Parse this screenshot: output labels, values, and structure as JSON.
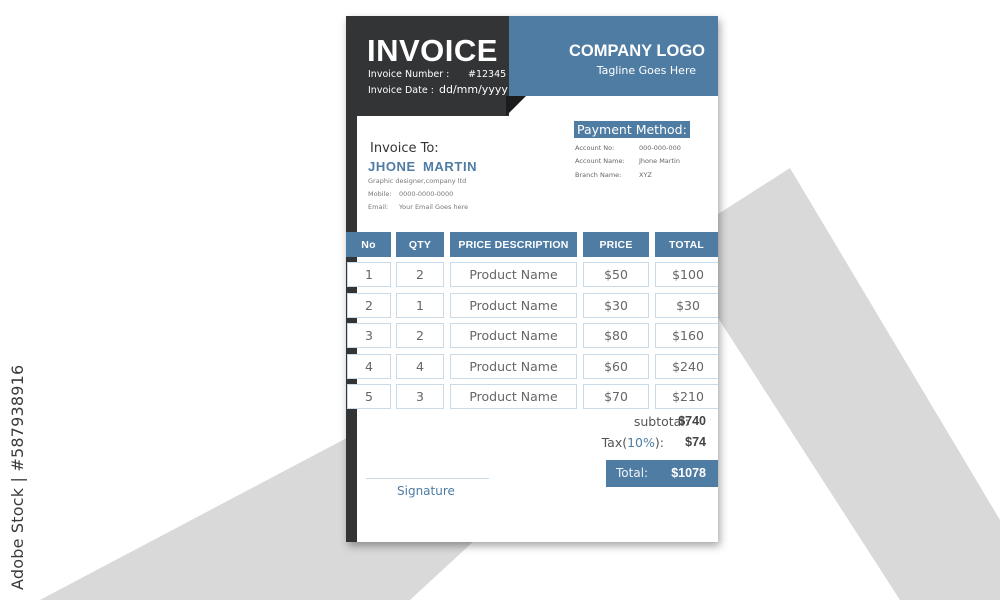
{
  "colors": {
    "accent": "#4f7ca3",
    "dark": "#333435",
    "background_shape": "#d9d9d9",
    "cell_border": "#c9dbe8"
  },
  "watermark": {
    "side_text": "Adobe Stock | #587938916",
    "overlay_text": "Adobe Stock"
  },
  "header": {
    "title": "INVOICE",
    "invoice_number_label": "Invoice Number :",
    "invoice_number": "#12345",
    "invoice_date_label": "Invoice Date :",
    "invoice_date": "dd/mm/yyyy",
    "company_logo": "COMPANY LOGO",
    "tagline": "Tagline Goes Here"
  },
  "bill_to": {
    "heading": "Invoice To:",
    "name": "JHONE  MARTIN",
    "role": "Graphic designer,company ltd",
    "mobile_label": "Mobile:",
    "mobile": "0000-0000-0000",
    "email_label": "Email:",
    "email": "Your Email Goes here"
  },
  "payment": {
    "heading": "Payment Method:",
    "account_no_label": "Account No:",
    "account_no": "000-000-000",
    "account_name_label": "Account Name:",
    "account_name": "Jhone Martin",
    "branch_label": "Branch Name:",
    "branch": "XYZ"
  },
  "table": {
    "columns": [
      "No",
      "QTY",
      "PRICE DESCRIPTION",
      "PRICE",
      "TOTAL"
    ],
    "rows": [
      [
        "1",
        "2",
        "Product Name",
        "$50",
        "$100"
      ],
      [
        "2",
        "1",
        "Product Name",
        "$30",
        "$30"
      ],
      [
        "3",
        "2",
        "Product Name",
        "$80",
        "$160"
      ],
      [
        "4",
        "4",
        "Product Name",
        "$60",
        "$240"
      ],
      [
        "5",
        "3",
        "Product Name",
        "$70",
        "$210"
      ]
    ]
  },
  "summary": {
    "subtotal_label": "subtotal:",
    "subtotal": "$740",
    "tax_label_prefix": "Tax(",
    "tax_rate": "10%",
    "tax_label_suffix": "):",
    "tax": "$74",
    "total_label": "Total:",
    "total": "$1078"
  },
  "signature": {
    "label": "Signature"
  }
}
